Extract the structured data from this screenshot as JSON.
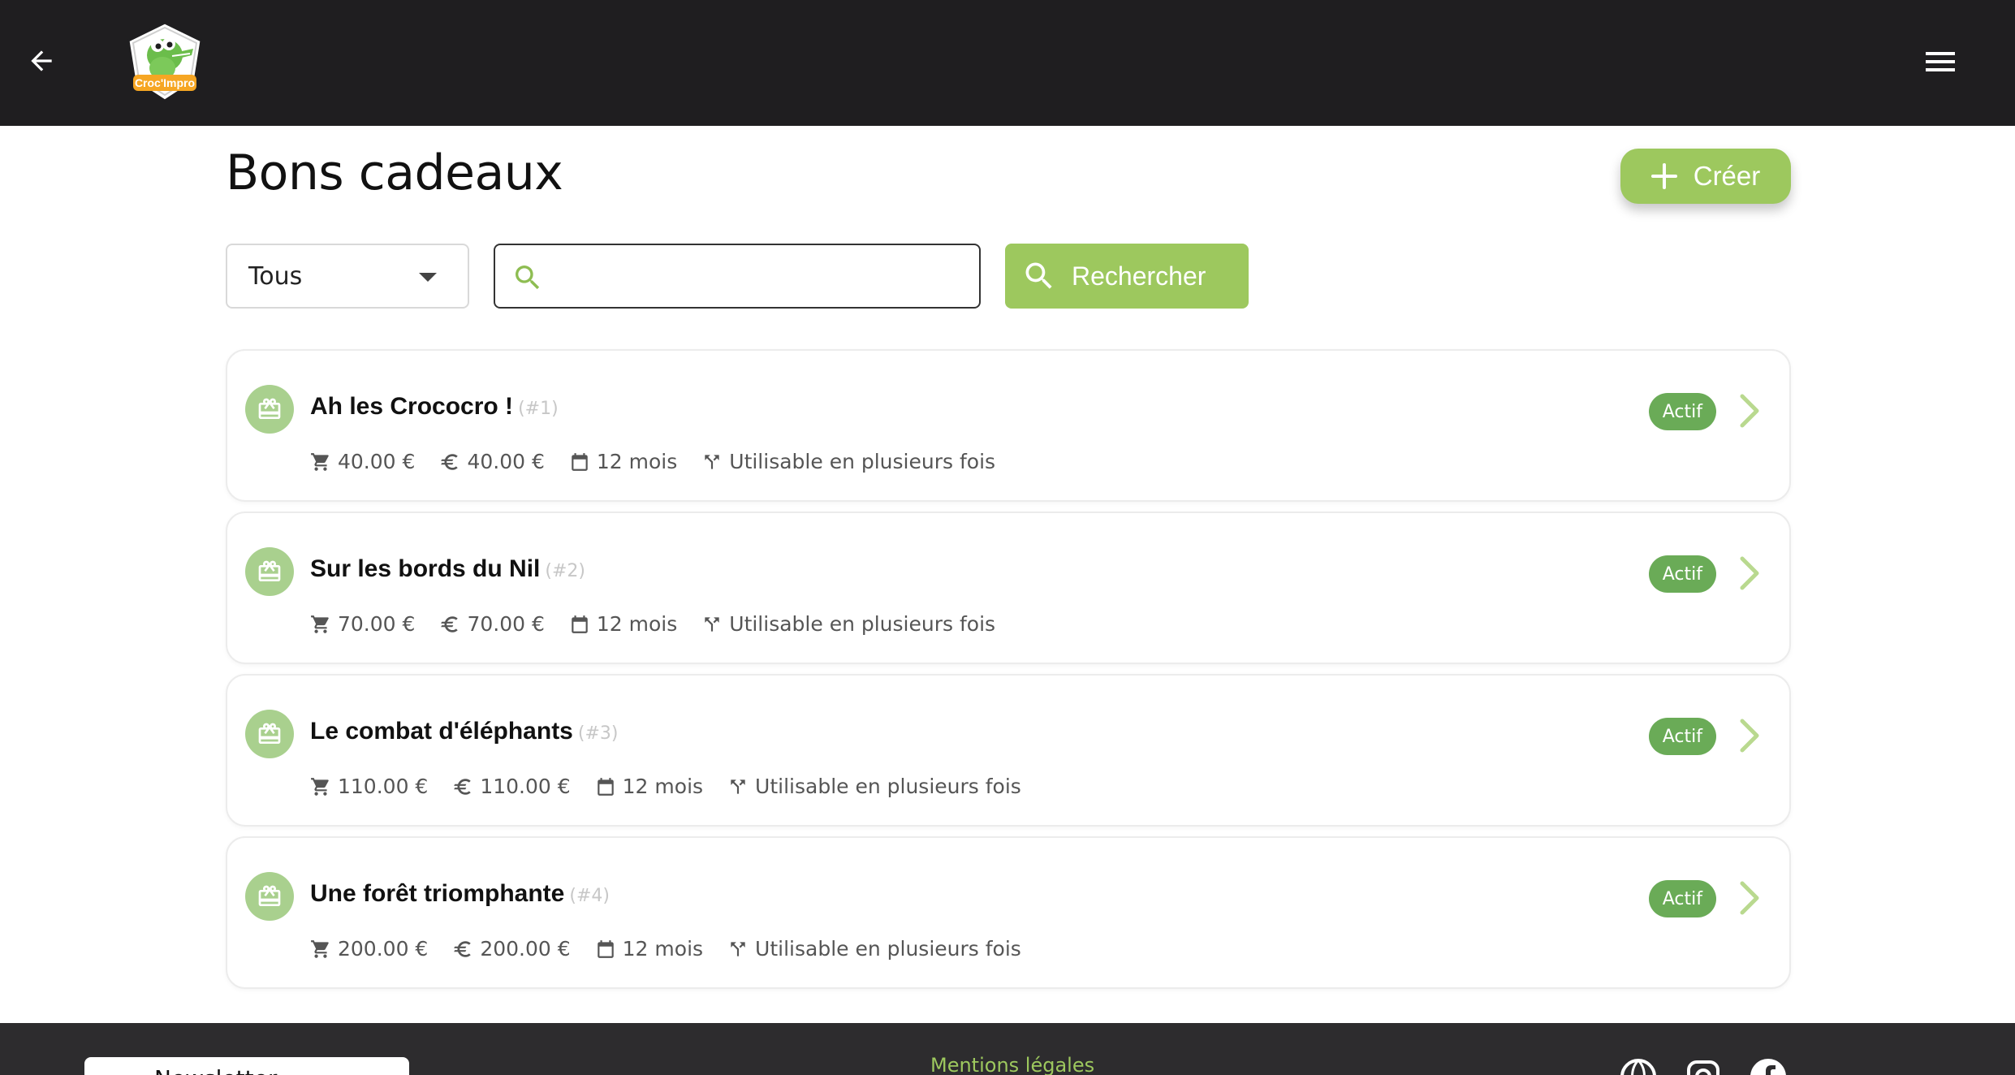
{
  "header": {
    "logo_text": "Croc'Impro",
    "back_icon": "arrow-left-icon",
    "menu_icon": "hamburger-menu-icon"
  },
  "page": {
    "title": "Bons cadeaux",
    "create_label": "Créer"
  },
  "filters": {
    "select_value": "Tous",
    "search_value": "",
    "search_button_label": "Rechercher"
  },
  "vouchers": [
    {
      "name": "Ah les Crococro !",
      "number": "(#1)",
      "price": "40.00 €",
      "value": "40.00 €",
      "duration": "12 mois",
      "usage": "Utilisable en plusieurs fois",
      "status": "Actif"
    },
    {
      "name": "Sur les bords du Nil",
      "number": "(#2)",
      "price": "70.00 €",
      "value": "70.00 €",
      "duration": "12 mois",
      "usage": "Utilisable en plusieurs fois",
      "status": "Actif"
    },
    {
      "name": "Le combat d'éléphants",
      "number": "(#3)",
      "price": "110.00 €",
      "value": "110.00 €",
      "duration": "12 mois",
      "usage": "Utilisable en plusieurs fois",
      "status": "Actif"
    },
    {
      "name": "Une forêt triomphante",
      "number": "(#4)",
      "price": "200.00 €",
      "value": "200.00 €",
      "duration": "12 mois",
      "usage": "Utilisable en plusieurs fois",
      "status": "Actif"
    }
  ],
  "footer": {
    "newsletter_label": "Newsletter",
    "mentions_label": "Mentions légales"
  },
  "colors": {
    "accent": "#9dc85e",
    "badge": "#6aab57",
    "header_bg": "#1f1e20"
  }
}
